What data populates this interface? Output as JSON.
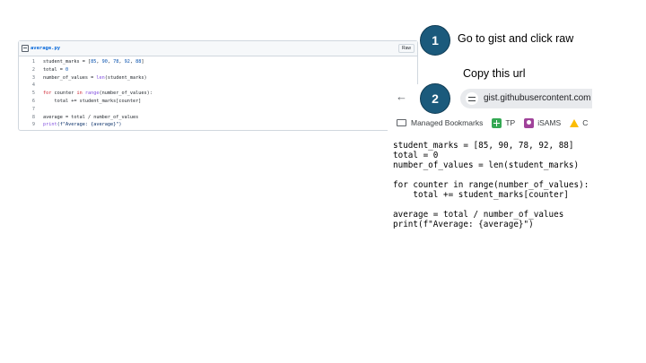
{
  "gist": {
    "filename": "average.py",
    "raw_label": "Raw",
    "lines": [
      {
        "n": "1",
        "segs": [
          {
            "t": "student_marks = [",
            "c": ""
          },
          {
            "t": "85",
            "c": "num"
          },
          {
            "t": ", ",
            "c": ""
          },
          {
            "t": "90",
            "c": "num"
          },
          {
            "t": ", ",
            "c": ""
          },
          {
            "t": "78",
            "c": "num"
          },
          {
            "t": ", ",
            "c": ""
          },
          {
            "t": "92",
            "c": "num"
          },
          {
            "t": ", ",
            "c": ""
          },
          {
            "t": "88",
            "c": "num"
          },
          {
            "t": "]",
            "c": ""
          }
        ]
      },
      {
        "n": "2",
        "segs": [
          {
            "t": "total = ",
            "c": ""
          },
          {
            "t": "0",
            "c": "num"
          }
        ]
      },
      {
        "n": "3",
        "segs": [
          {
            "t": "number_of_values = ",
            "c": ""
          },
          {
            "t": "len",
            "c": "fn"
          },
          {
            "t": "(student_marks)",
            "c": ""
          }
        ]
      },
      {
        "n": "4",
        "segs": [
          {
            "t": "",
            "c": ""
          }
        ]
      },
      {
        "n": "5",
        "segs": [
          {
            "t": "for",
            "c": "kw"
          },
          {
            "t": " counter ",
            "c": ""
          },
          {
            "t": "in",
            "c": "kw"
          },
          {
            "t": " ",
            "c": ""
          },
          {
            "t": "range",
            "c": "fn"
          },
          {
            "t": "(number_of_values):",
            "c": ""
          }
        ]
      },
      {
        "n": "6",
        "segs": [
          {
            "t": "    total += student_marks[counter]",
            "c": ""
          }
        ]
      },
      {
        "n": "7",
        "segs": [
          {
            "t": "",
            "c": ""
          }
        ]
      },
      {
        "n": "8",
        "segs": [
          {
            "t": "average = total / number_of_values",
            "c": ""
          }
        ]
      },
      {
        "n": "9",
        "segs": [
          {
            "t": "print",
            "c": "fn"
          },
          {
            "t": "(f\"Average: {average}\")",
            "c": "str"
          }
        ]
      }
    ]
  },
  "steps": [
    {
      "number": "1",
      "text": "Go to gist and click raw"
    },
    {
      "number": "2",
      "text": "Copy this url"
    }
  ],
  "browser": {
    "back_icon": "back-arrow-icon",
    "url": "gist.githubusercontent.com",
    "bookmarks": [
      {
        "icon": "folder-icon",
        "label": "Managed Bookmarks"
      },
      {
        "icon": "tp-icon",
        "label": "TP"
      },
      {
        "icon": "isams-icon",
        "label": "iSAMS"
      },
      {
        "icon": "drive-icon",
        "label": "C"
      }
    ]
  },
  "raw_code": [
    "student_marks = [85, 90, 78, 92, 88]",
    "total = 0",
    "number_of_values = len(student_marks)",
    "",
    "for counter in range(number_of_values):",
    "    total += student_marks[counter]",
    "",
    "average = total / number_of_values",
    "print(f\"Average: {average}\")"
  ],
  "colors": {
    "badge": "#1b5a7c",
    "link": "#0969da",
    "keyword": "#cf222e",
    "number": "#0550ae",
    "function": "#8250df"
  }
}
